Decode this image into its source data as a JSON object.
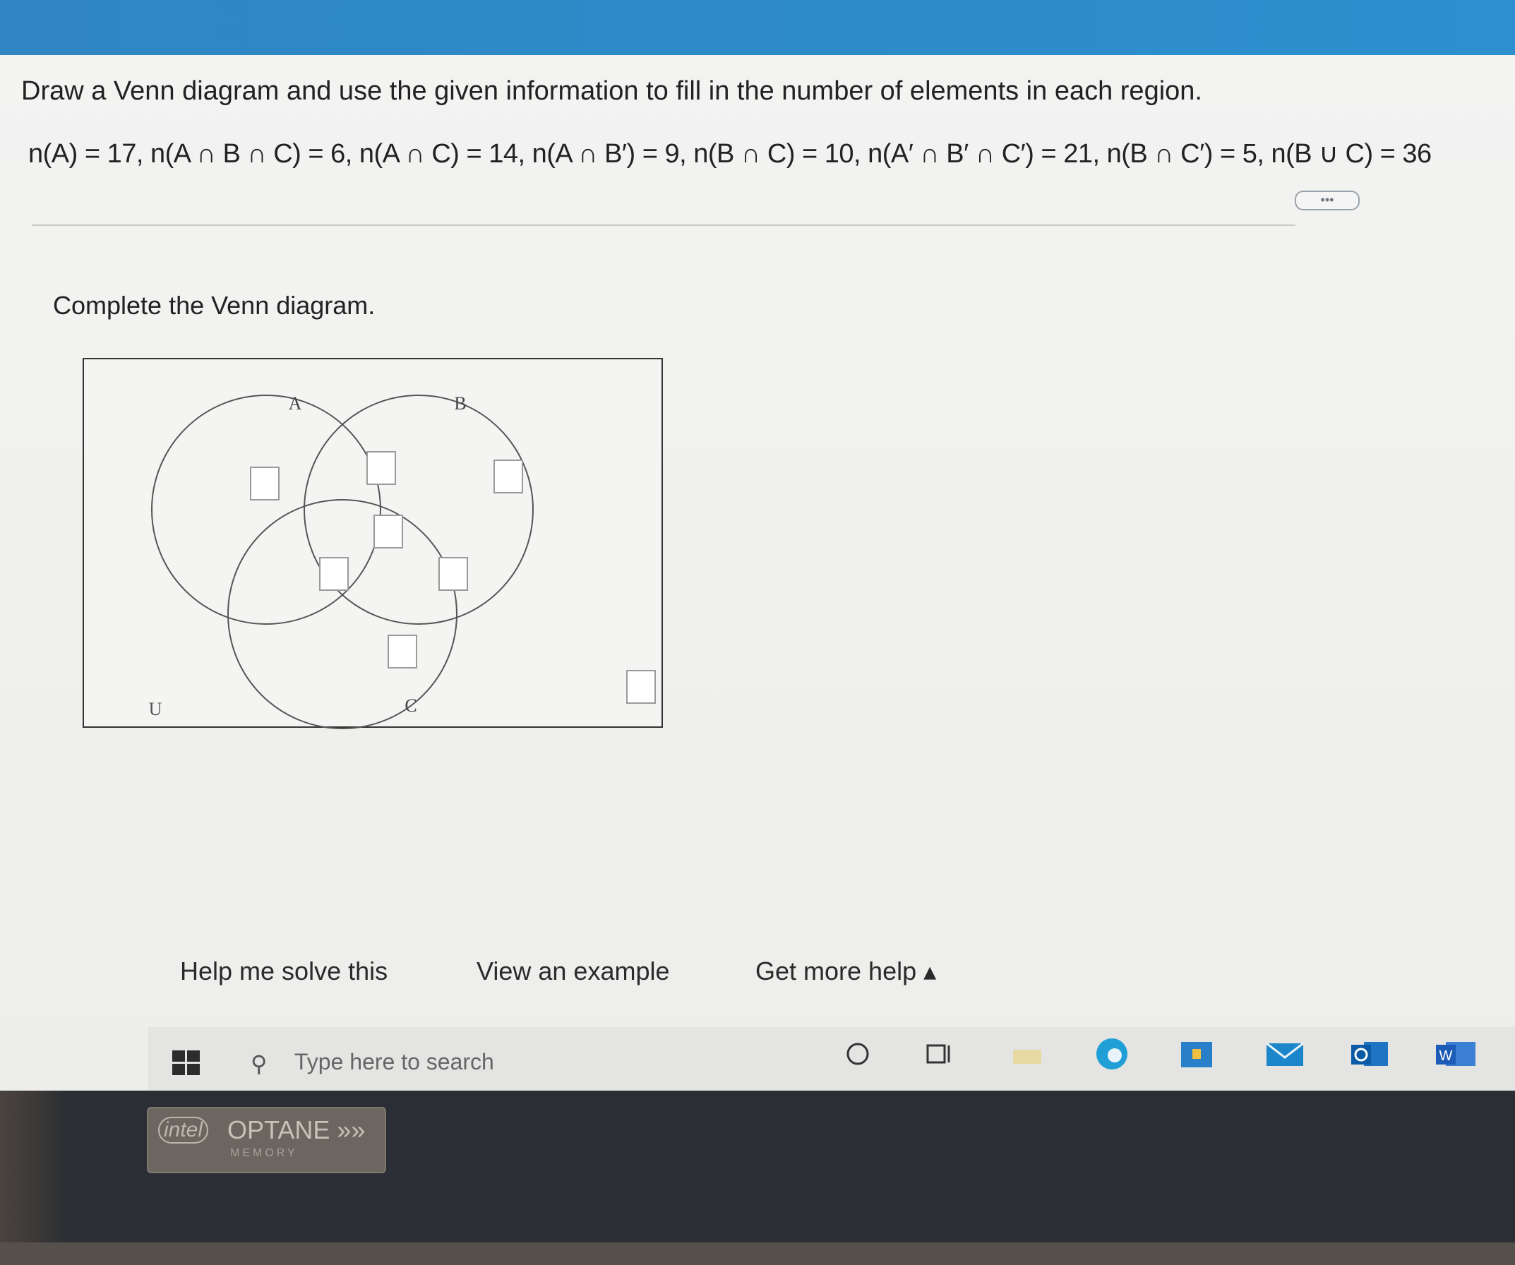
{
  "question": {
    "title": "Draw a Venn diagram and use the given information to fill in the number of elements in each region.",
    "given": "n(A) = 17, n(A ∩ B ∩ C) = 6, n(A ∩ C) = 14, n(A ∩ B′) = 9, n(B ∩ C) = 10, n(A′ ∩ B′ ∩ C′) = 21, n(B ∩ C′) = 5, n(B ∪ C) = 36",
    "more_label": "•••"
  },
  "instruction": "Complete the Venn diagram.",
  "venn": {
    "label_a": "A",
    "label_b": "B",
    "label_c": "C",
    "label_u": "U",
    "region_values": {
      "a_only": "",
      "a_and_b_only": "",
      "b_only": "",
      "a_b_c": "",
      "a_and_c_only": "",
      "b_and_c_only": "",
      "c_only": "",
      "outside": ""
    }
  },
  "help": {
    "solve": "Help me solve this",
    "example": "View an example",
    "more": "Get more help ▴"
  },
  "taskbar": {
    "search_placeholder": "Type here to search",
    "icons": [
      "windows-icon",
      "cortana-icon",
      "task-view-icon",
      "file-explorer-icon",
      "edge-icon",
      "store-icon",
      "mail-icon",
      "outlook-icon",
      "word-icon"
    ]
  },
  "sticker": {
    "brand": "intel",
    "name": "OPTANE »»",
    "sub": "MEMORY"
  }
}
